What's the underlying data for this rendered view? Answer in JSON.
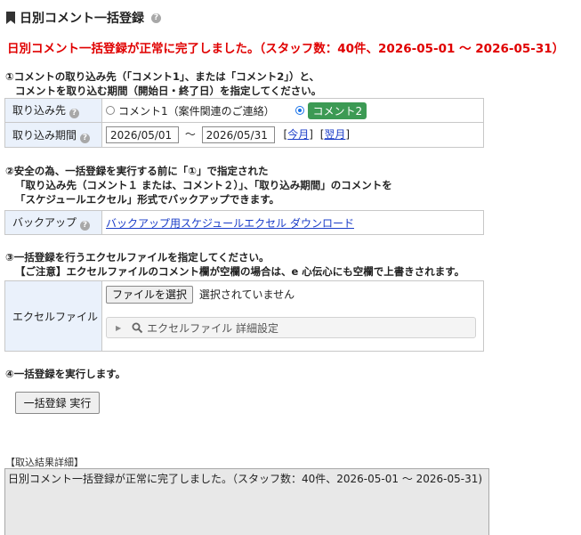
{
  "header": {
    "title": "日別コメント一括登録"
  },
  "message": {
    "success": "日別コメント一括登録が正常に完了しました。（スタッフ数：40件、2026-05-01 〜 2026-05-31）"
  },
  "step1": {
    "line1": "①コメントの取り込み先（「コメント1」、または「コメント2」）と、",
    "line2": "コメントを取り込む期間（開始日・終了日）を指定してください。",
    "target_label": "取り込み先",
    "option1": "コメント1（案件関連のご連絡）",
    "option2": "コメント2",
    "selected": "コメント2",
    "period_label": "取り込み期間",
    "start_date": "2026/05/01",
    "separator": "〜",
    "end_date": "2026/05/31",
    "this_month": "今月",
    "next_month": "翌月",
    "bracket_open": "[",
    "bracket_close": "]"
  },
  "step2": {
    "line1": "②安全の為、一括登録を実行する前に「①」で指定された",
    "line2": "「取り込み先（コメント１ または、コメント２）」、「取り込み期間」のコメントを",
    "line3": "「スケジュールエクセル」形式でバックアップできます。",
    "backup_label": "バックアップ",
    "backup_link": "バックアップ用スケジュールエクセル ダウンロード"
  },
  "step3": {
    "line1": "③一括登録を行うエクセルファイルを指定してください。",
    "line2": "【ご注意】エクセルファイルのコメント欄が空欄の場合は、e 心伝心にも空欄で上書きされます。",
    "file_label": "エクセルファイル",
    "choose_button": "ファイルを選択",
    "no_file": "選択されていません",
    "detail_settings": "エクセルファイル 詳細設定"
  },
  "step4": {
    "line1": "④一括登録を実行します。",
    "execute_button": "一括登録 実行"
  },
  "result": {
    "label": "【取込結果詳細】",
    "text": "日別コメント一括登録が正常に完了しました。（スタッフ数：40件、2026-05-01 〜 2026-05-31)"
  },
  "colors": {
    "error": "#e00000",
    "accent_green": "#3c9a54",
    "header_bg": "#eaf1fb",
    "link": "#1a3cc8"
  },
  "icons": {
    "title": "bookmark-icon",
    "help": "help-icon",
    "search": "search-icon",
    "expand": "caret-right-icon"
  }
}
